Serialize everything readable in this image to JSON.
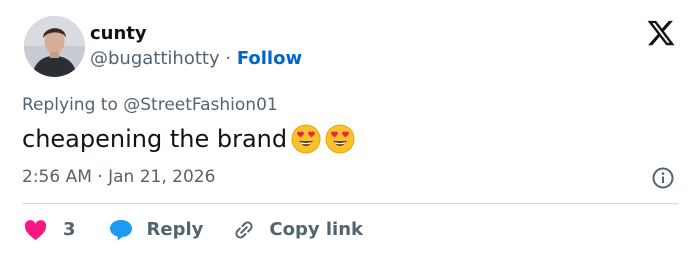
{
  "author": {
    "display_name": "cunty",
    "handle": "@bugattihotty",
    "separator": "·",
    "follow_label": "Follow"
  },
  "reply_to": "Replying to @StreetFashion01",
  "tweet": {
    "text": "cheapening the brand",
    "emojis": [
      "heart-eyes-emoji",
      "heart-eyes-emoji"
    ]
  },
  "timestamp": "2:56 AM · Jan 21, 2026",
  "actions": {
    "like_count": "3",
    "reply_label": "Reply",
    "copy_link_label": "Copy link"
  },
  "colors": {
    "like": "#f91880",
    "reply_bubble": "#1d9bf0",
    "follow": "#0066cc",
    "secondary_text": "#536471",
    "primary_text": "#0f1419"
  },
  "icons": {
    "brand": "x-logo-icon",
    "info": "info-icon",
    "like": "heart-icon",
    "reply": "speech-bubble-icon",
    "copy_link": "link-icon"
  }
}
